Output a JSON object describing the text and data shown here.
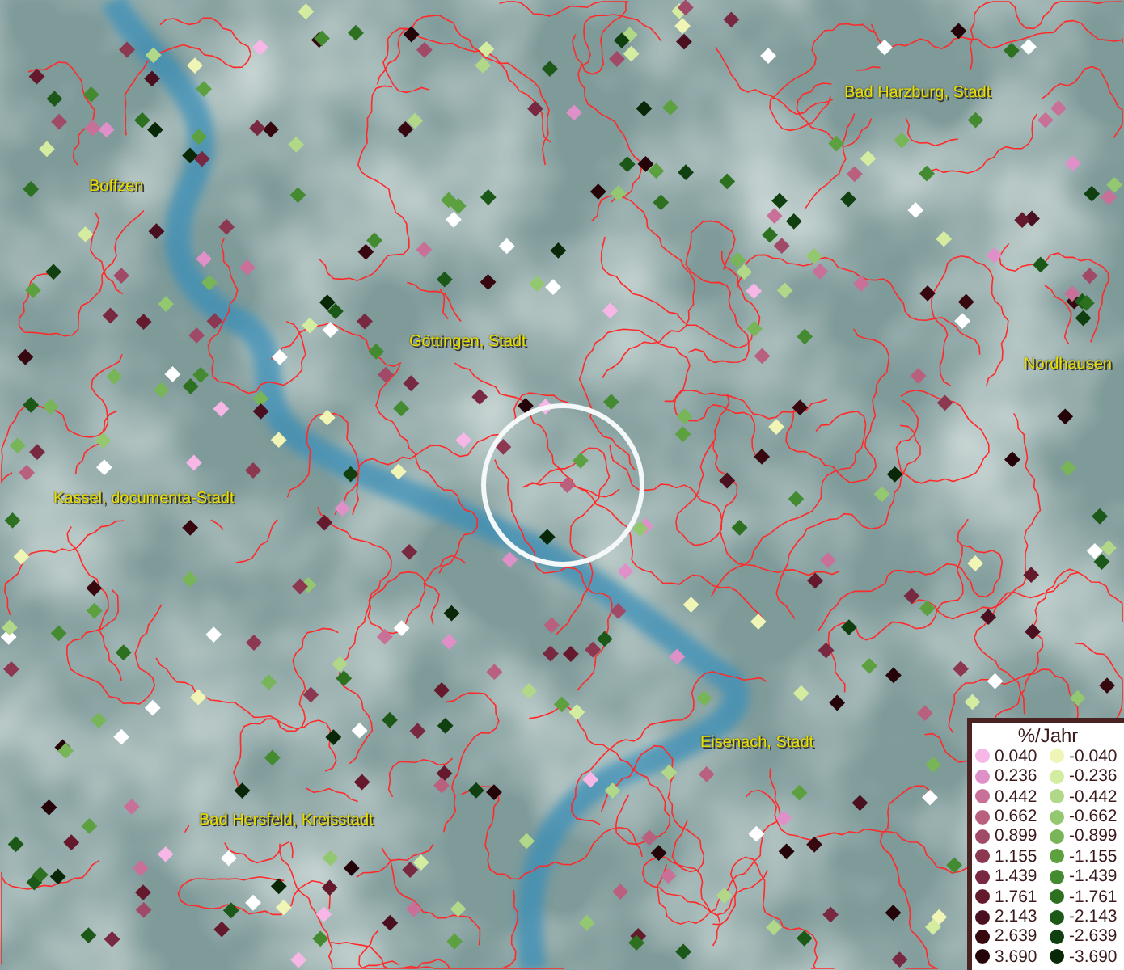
{
  "map": {
    "places": [
      {
        "name": "Bad Harzburg, Stadt"
      },
      {
        "name": "Boffzen"
      },
      {
        "name": "Göttingen, Stadt"
      },
      {
        "name": "Nordhausen"
      },
      {
        "name": "Kassel, documenta-Stadt"
      },
      {
        "name": "Eisenach, Stadt"
      },
      {
        "name": "Bad Hersfeld, Kreisstadt"
      }
    ]
  },
  "legend": {
    "title": "%/Jahr",
    "classes": [
      {
        "label": "0.040",
        "color": "#f6b6e6"
      },
      {
        "label": "-0.040",
        "color": "#f0f4b4"
      },
      {
        "label": "0.236",
        "color": "#e090c8"
      },
      {
        "label": "-0.236",
        "color": "#d4eca0"
      },
      {
        "label": "0.442",
        "color": "#c87098"
      },
      {
        "label": "-0.442",
        "color": "#b0d888"
      },
      {
        "label": "0.662",
        "color": "#b8607e"
      },
      {
        "label": "-0.662",
        "color": "#94c870"
      },
      {
        "label": "0.899",
        "color": "#a04a68"
      },
      {
        "label": "-0.899",
        "color": "#78b458"
      },
      {
        "label": "1.155",
        "color": "#8c3850"
      },
      {
        "label": "-1.155",
        "color": "#5ca040"
      },
      {
        "label": "1.439",
        "color": "#782840"
      },
      {
        "label": "-1.439",
        "color": "#448a30"
      },
      {
        "label": "1.761",
        "color": "#641a2c"
      },
      {
        "label": "-1.761",
        "color": "#2c7020"
      },
      {
        "label": "2.143",
        "color": "#4a1020"
      },
      {
        "label": "-2.143",
        "color": "#1c5818"
      },
      {
        "label": "2.639",
        "color": "#380810"
      },
      {
        "label": "-2.639",
        "color": "#104010"
      },
      {
        "label": "3.690",
        "color": "#240408"
      },
      {
        "label": "-3.690",
        "color": "#082808"
      }
    ]
  }
}
